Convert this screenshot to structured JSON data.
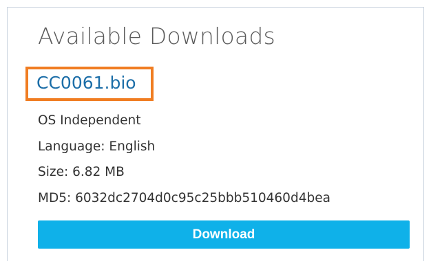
{
  "section": {
    "title": "Available Downloads"
  },
  "file": {
    "name": "CC0061.bio",
    "os": "OS Independent",
    "language": "Language: English",
    "size": "Size: 6.82 MB",
    "md5": "MD5: 6032dc2704d0c95c25bbb510460d4bea"
  },
  "actions": {
    "download_label": "Download"
  },
  "colors": {
    "link": "#1c6ea8",
    "highlight": "#f07d22",
    "button": "#0fb1e9"
  }
}
